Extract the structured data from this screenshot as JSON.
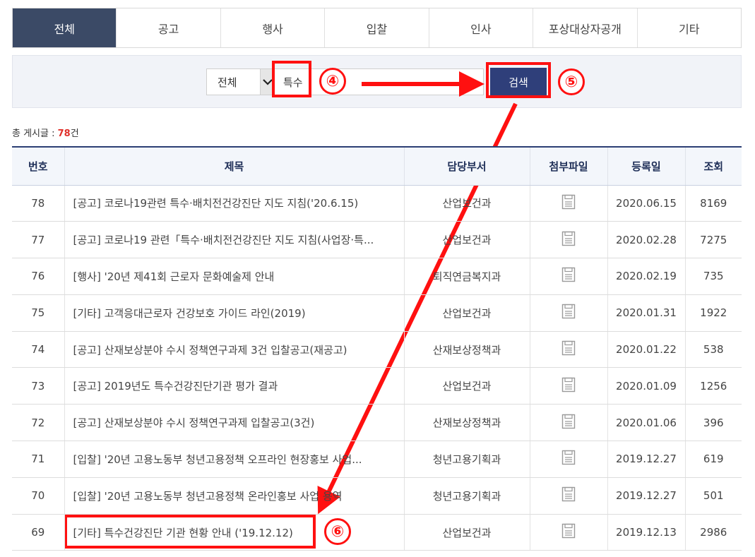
{
  "tabs": [
    {
      "label": "전체",
      "active": true
    },
    {
      "label": "공고",
      "active": false
    },
    {
      "label": "행사",
      "active": false
    },
    {
      "label": "입찰",
      "active": false
    },
    {
      "label": "인사",
      "active": false
    },
    {
      "label": "포상대상자공개",
      "active": false
    },
    {
      "label": "기타",
      "active": false
    }
  ],
  "search": {
    "select_value": "전체",
    "input_value": "특수",
    "button_label": "검색"
  },
  "annotations": {
    "step4": "④",
    "step5": "⑤",
    "step6": "⑥",
    "color": "#ff1010"
  },
  "total": {
    "label": "총 게시글 : ",
    "count": "78",
    "suffix": "건"
  },
  "table": {
    "headers": [
      "번호",
      "제목",
      "담당부서",
      "첨부파일",
      "등록일",
      "조회"
    ],
    "rows": [
      {
        "no": "78",
        "title": "[공고] 코로나19관련 특수·배치전건강진단 지도 지침('20.6.15)",
        "dept": "산업보건과",
        "date": "2020.06.15",
        "views": "8169"
      },
      {
        "no": "77",
        "title": "[공고] 코로나19 관련「특수·배치전건강진단 지도 지침(사업장·특...",
        "dept": "산업보건과",
        "date": "2020.02.28",
        "views": "7275"
      },
      {
        "no": "76",
        "title": "[행사] '20년 제41회 근로자 문화예술제 안내",
        "dept": "퇴직연금복지과",
        "date": "2020.02.19",
        "views": "735"
      },
      {
        "no": "75",
        "title": "[기타] 고객응대근로자 건강보호 가이드 라인(2019)",
        "dept": "산업보건과",
        "date": "2020.01.31",
        "views": "1922"
      },
      {
        "no": "74",
        "title": "[공고] 산재보상분야 수시 정책연구과제 3건 입찰공고(재공고)",
        "dept": "산재보상정책과",
        "date": "2020.01.22",
        "views": "538"
      },
      {
        "no": "73",
        "title": "[공고] 2019년도 특수건강진단기관 평가 결과",
        "dept": "산업보건과",
        "date": "2020.01.09",
        "views": "1256"
      },
      {
        "no": "72",
        "title": "[공고] 산재보상분야 수시 정책연구과제 입찰공고(3건)",
        "dept": "산재보상정책과",
        "date": "2020.01.06",
        "views": "396"
      },
      {
        "no": "71",
        "title": "[입찰] '20년 고용노동부 청년고용정책 오프라인 현장홍보 사업...",
        "dept": "청년고용기획과",
        "date": "2019.12.27",
        "views": "619"
      },
      {
        "no": "70",
        "title": "[입찰] '20년 고용노동부 청년고용정책 온라인홍보 사업 용역",
        "dept": "청년고용기획과",
        "date": "2019.12.27",
        "views": "501"
      },
      {
        "no": "69",
        "title": "[기타] 특수건강진단 기관 현황 안내 ('19.12.12)",
        "dept": "산업보건과",
        "date": "2019.12.13",
        "views": "2986"
      }
    ]
  }
}
